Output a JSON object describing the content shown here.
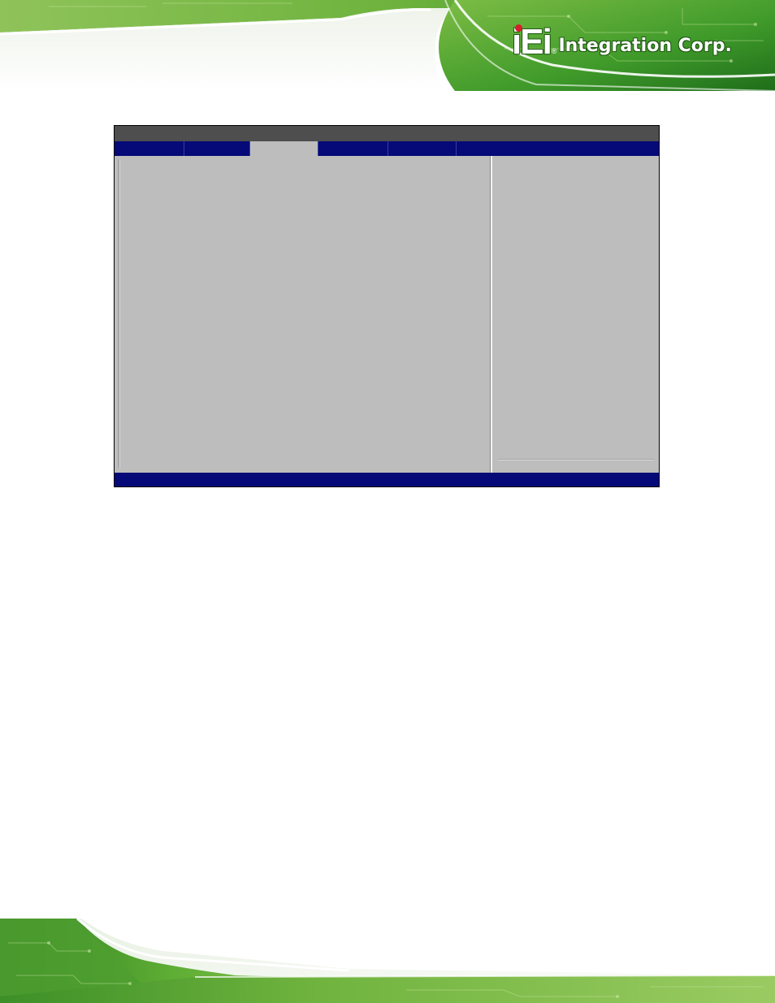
{
  "header": {
    "logo_mark": "iEi",
    "logo_registered": "®",
    "logo_wordmark": "Integration Corp."
  },
  "bios": {
    "title": "",
    "tabs": [
      {
        "label": "",
        "active": false
      },
      {
        "label": "",
        "active": false
      },
      {
        "label": "",
        "active": true
      },
      {
        "label": "",
        "active": false
      },
      {
        "label": "",
        "active": false
      }
    ],
    "status_text": ""
  },
  "colors": {
    "bios_menu_blue": "#050a78",
    "bios_gray": "#bdbdbd",
    "bios_title_gray": "#4e4e4e",
    "banner_green": "#3f9a2a",
    "logo_red": "#d4202a"
  }
}
